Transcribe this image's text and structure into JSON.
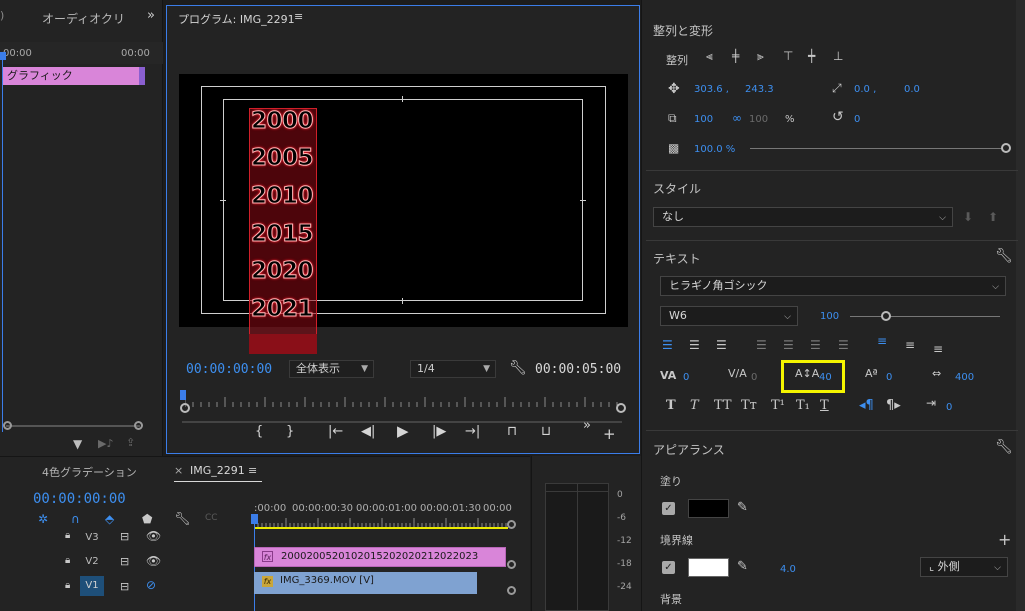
{
  "source_panel": {
    "tab_label": "オーディオクリ",
    "tc_start": "00:00",
    "tc_end": "00:00",
    "clip_label": "グラフィック"
  },
  "program": {
    "title": "プログラム: IMG_2291",
    "timecode": "00:00:00:00",
    "zoom": "全体表示",
    "resolution": "1/4",
    "duration": "00:00:05:00",
    "years": [
      "2000",
      "2005",
      "2010",
      "2015",
      "2020",
      "2021"
    ]
  },
  "graphics": {
    "align_section": "整列と変形",
    "align_label": "整列",
    "position_x": "303.6 ,",
    "position_y": "243.3",
    "anchor_x": "0.0 ,",
    "anchor_y": "0.0",
    "scale": "100",
    "scale_linked": "100",
    "scale_unit": "%",
    "rotation": "0",
    "opacity": "100.0 %",
    "style_section": "スタイル",
    "style_value": "なし",
    "text_section": "テキスト",
    "font": "ヒラギノ角ゴシック",
    "weight": "W6",
    "font_size": "100",
    "kerning": "0",
    "tracking": "0",
    "leading": "40",
    "baseline": "0",
    "tsume": "400",
    "tab_width": "0",
    "appearance_section": "アピアランス",
    "fill_label": "塗り",
    "stroke_label": "境界線",
    "stroke_width": "4.0",
    "stroke_position": "外側",
    "background_label": "背景"
  },
  "timeline": {
    "tab1": "4色グラデーション",
    "tab2": "IMG_2291",
    "timecode": "00:00:00:00",
    "ruler": [
      ":00:00",
      "00:00:00:30",
      "00:00:01:00",
      "00:00:01:30",
      "00:00"
    ],
    "tracks": [
      "V3",
      "V2",
      "V1"
    ],
    "clip_graphic": "2000200520102015202020212022023",
    "clip_video": "IMG_3369.MOV [V]"
  },
  "meters": {
    "db_labels": [
      "0",
      "-6",
      "-12",
      "-18",
      "-24"
    ]
  }
}
